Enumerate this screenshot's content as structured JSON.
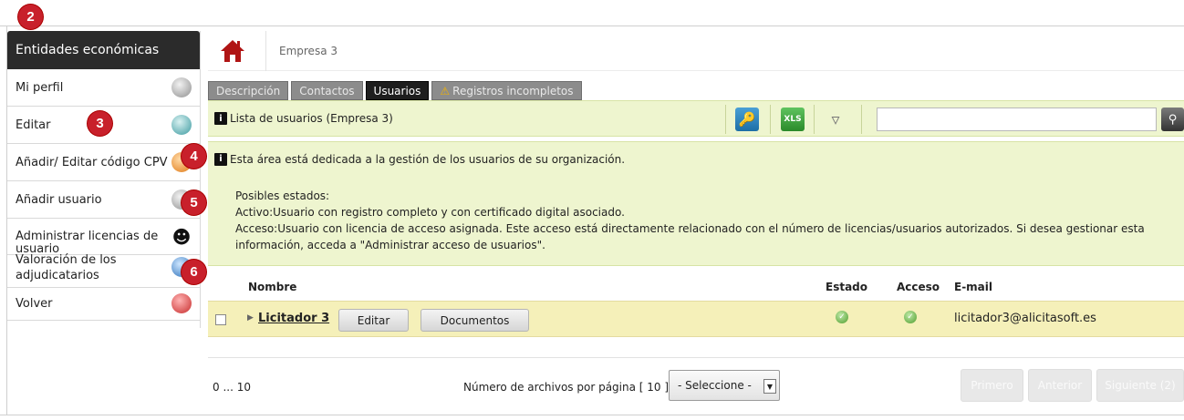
{
  "callouts": [
    "2",
    "3",
    "4",
    "5",
    "6"
  ],
  "sidebar": {
    "header": "Entidades económicas",
    "items": [
      {
        "label": "Mi perfil",
        "icon": "profile-icon"
      },
      {
        "label": "Editar",
        "icon": "edit-icon"
      },
      {
        "label": "Añadir/ Editar código CPV",
        "icon": "cpv-icon"
      },
      {
        "label": "Añadir usuario",
        "icon": "add-user-icon"
      },
      {
        "label_1": "Administrar licencias de",
        "label_2": "usuario",
        "icon": "users-group-icon"
      },
      {
        "label_1": "Valoración de los",
        "label_2": "adjudicatarios",
        "icon": "globe-icon"
      },
      {
        "label": "Volver",
        "icon": "back-icon"
      }
    ]
  },
  "breadcrumb": {
    "current": "Empresa 3"
  },
  "tabs": [
    {
      "label": "Descripción"
    },
    {
      "label": "Contactos"
    },
    {
      "label": "Usuarios"
    },
    {
      "label": "Registros incompletos"
    }
  ],
  "toolbar": {
    "title": "Lista de usuarios (Empresa 3)",
    "xls_label": "XLS",
    "search_value": ""
  },
  "info": {
    "line1": "Esta área está dedicada a la gestión de los usuarios de su organización.",
    "states_title": "Posibles estados:",
    "activo": "Activo:Usuario con registro completo y con certificado digital asociado.",
    "acceso_1": "Acceso:Usuario con licencia de acceso asignada. Este acceso está directamente relacionado con el número de licencias/usuarios autorizados. Si desea gestionar esta",
    "acceso_2": "información, acceda a \"Administrar acceso de usuarios\"."
  },
  "table": {
    "headers": {
      "nombre": "Nombre",
      "estado": "Estado",
      "acceso": "Acceso",
      "email": "E-mail"
    },
    "rows": [
      {
        "name": "Licitador 3",
        "edit_label": "Editar",
        "docs_label": "Documentos",
        "estado": "ok",
        "acceso": "ok",
        "email": "licitador3@alicitasoft.es"
      }
    ]
  },
  "footer": {
    "range": "0 ... 10",
    "per_page": "Número de archivos por página [ 10 ]",
    "select_value": "- Seleccione -",
    "first": "Primero",
    "prev": "Anterior",
    "next": "Siguiente (2)"
  },
  "colors": {
    "accent_bar": "#eef5cf",
    "row_highlight": "#f5f0b9",
    "sidebar_header": "#2b2b2b",
    "callout": "#c8202b"
  }
}
